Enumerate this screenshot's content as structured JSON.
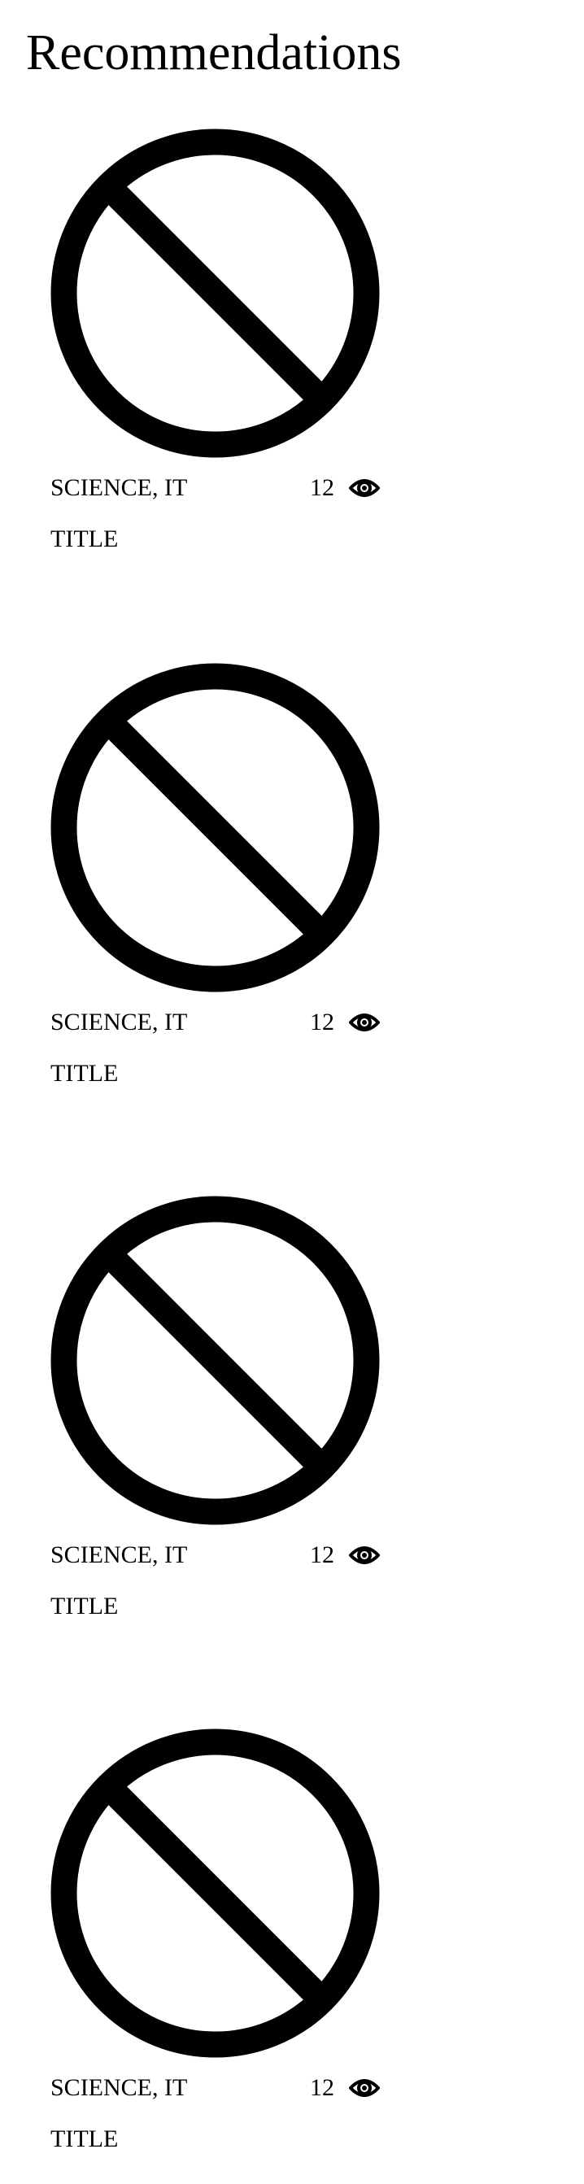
{
  "page": {
    "title": "Recommendations"
  },
  "recommendations": [
    {
      "category": "SCIENCE, IT",
      "views": "12",
      "title": "TITLE",
      "thumbnail_icon": "no-image-icon",
      "views_icon": "eye-icon"
    },
    {
      "category": "SCIENCE, IT",
      "views": "12",
      "title": "TITLE",
      "thumbnail_icon": "no-image-icon",
      "views_icon": "eye-icon"
    },
    {
      "category": "SCIENCE, IT",
      "views": "12",
      "title": "TITLE",
      "thumbnail_icon": "no-image-icon",
      "views_icon": "eye-icon"
    },
    {
      "category": "SCIENCE, IT",
      "views": "12",
      "title": "TITLE",
      "thumbnail_icon": "no-image-icon",
      "views_icon": "eye-icon"
    }
  ]
}
